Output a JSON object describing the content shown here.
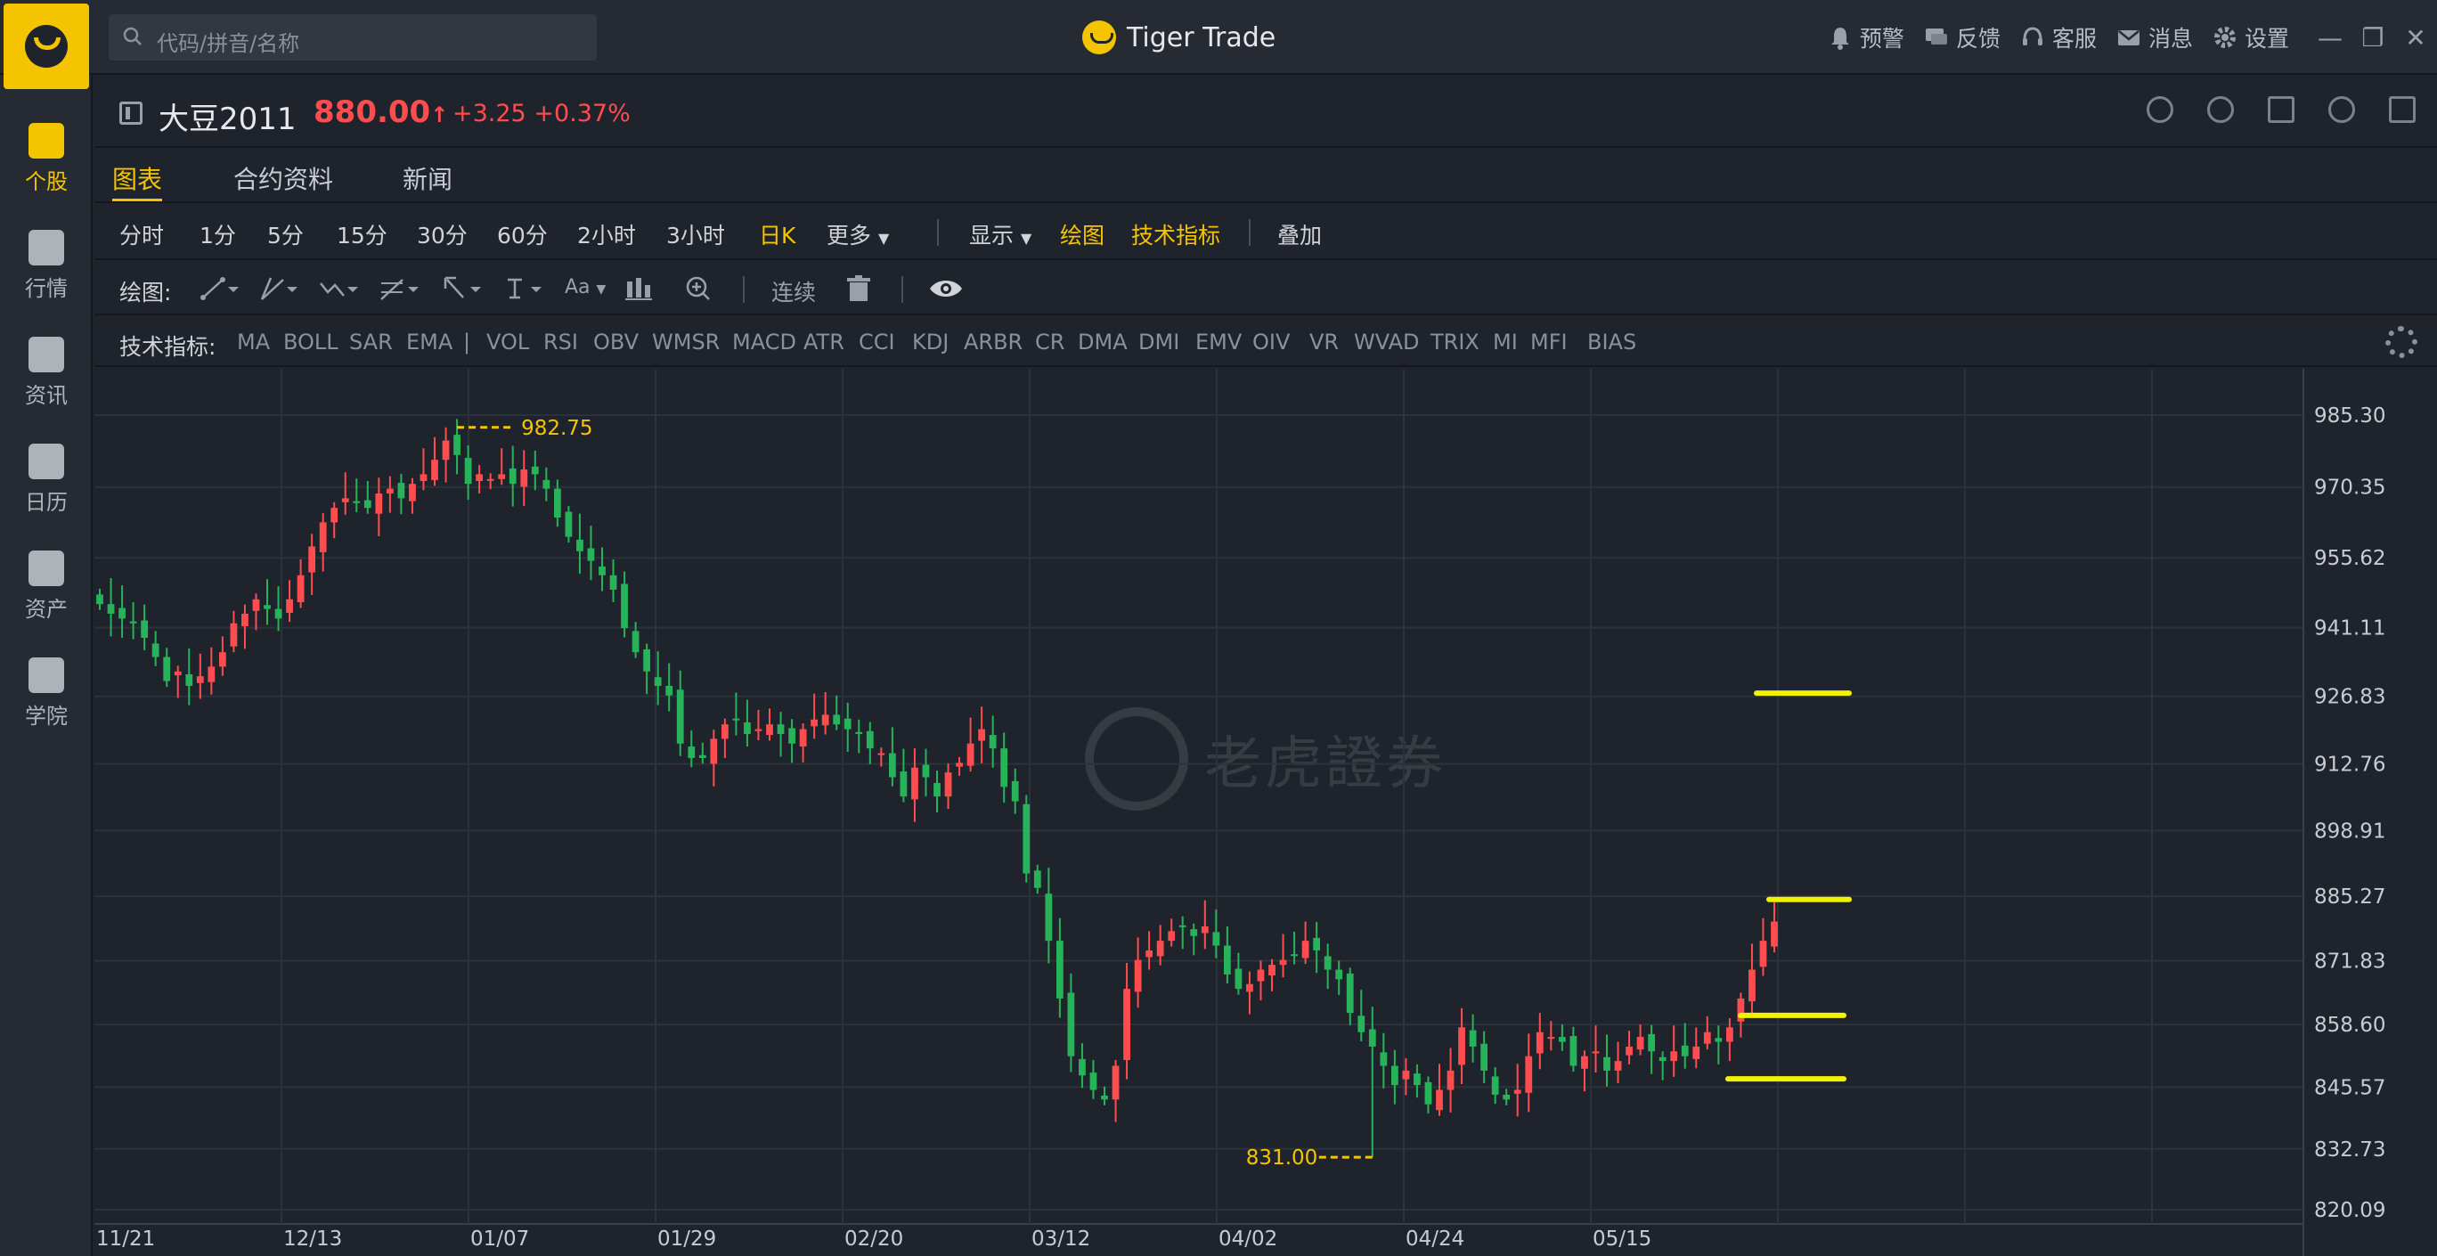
{
  "app": {
    "brand": "Tiger Trade"
  },
  "search": {
    "placeholder": "代码/拼音/名称"
  },
  "top_nav": [
    {
      "label": "预警",
      "icon": "bell-icon"
    },
    {
      "label": "反馈",
      "icon": "chat-icon"
    },
    {
      "label": "客服",
      "icon": "headset-icon"
    },
    {
      "label": "消息",
      "icon": "mail-icon"
    },
    {
      "label": "设置",
      "icon": "gear-icon"
    }
  ],
  "window_controls": {
    "minimize": "—",
    "restore": "❐",
    "close": "✕"
  },
  "sidebar": [
    {
      "label": "个股",
      "icon": "stock-icon",
      "active": true
    },
    {
      "label": "行情",
      "icon": "market-icon",
      "active": false
    },
    {
      "label": "资讯",
      "icon": "news-icon",
      "active": false
    },
    {
      "label": "日历",
      "icon": "calendar-icon",
      "active": false
    },
    {
      "label": "资产",
      "icon": "wallet-icon",
      "active": false
    },
    {
      "label": "学院",
      "icon": "play-icon",
      "active": false
    }
  ],
  "quote": {
    "symbol": "大豆2011",
    "price": "880.00",
    "arrow": "↑",
    "change": "+3.25 +0.37%"
  },
  "tabs": [
    "图表",
    "合约资料",
    "新闻"
  ],
  "periods": [
    "分时",
    "1分",
    "5分",
    "15分",
    "30分",
    "60分",
    "2小时",
    "3小时",
    "日K",
    "更多"
  ],
  "period_selected": "日K",
  "display_menu": {
    "display": "显示",
    "draw": "绘图",
    "indicators": "技术指标",
    "overlay": "叠加"
  },
  "draw_toolbar": {
    "label": "绘图:",
    "continuous": "连续",
    "font_tool": "Aa"
  },
  "indicators": {
    "label": "技术指标:",
    "items": [
      "MA",
      "BOLL",
      "SAR",
      "EMA",
      "|",
      "VOL",
      "RSI",
      "OBV",
      "WMSR",
      "MACD",
      "ATR",
      "CCI",
      "KDJ",
      "ARBR",
      "CR",
      "DMA",
      "DMI",
      "EMV",
      "OIV",
      "VR",
      "WVAD",
      "TRIX",
      "MI",
      "MFI",
      "BIAS"
    ]
  },
  "watermark": {
    "text": "老虎證券"
  },
  "colors": {
    "accent": "#f5c400",
    "up": "#ff4d4f",
    "down": "#26b35a",
    "background": "#1f242c"
  },
  "chart_data": {
    "type": "candlestick",
    "title": "",
    "x_ticks": [
      "11/21",
      "12/13",
      "01/07",
      "01/29",
      "02/20",
      "03/12",
      "04/02",
      "04/24",
      "05/15"
    ],
    "y_ticks": [
      "985.30",
      "970.35",
      "955.62",
      "941.11",
      "926.83",
      "912.76",
      "898.91",
      "885.27",
      "871.83",
      "858.60",
      "845.57",
      "832.73",
      "820.09"
    ],
    "ylim": [
      820.09,
      985.3
    ],
    "annotations": [
      {
        "text": "982.75",
        "value": 982.75,
        "type": "high"
      },
      {
        "text": "831.00",
        "value": 831.0,
        "type": "low"
      }
    ],
    "user_lines": [
      927.5,
      884.6,
      860.5,
      847.3
    ],
    "closes": [
      946,
      944,
      943,
      942,
      939,
      935,
      930,
      932,
      929,
      931,
      933,
      936,
      942,
      944,
      947,
      945,
      943,
      947,
      952,
      958,
      963,
      966,
      968,
      967,
      966,
      969,
      970,
      968,
      971,
      973,
      976,
      980,
      977,
      971,
      973,
      972,
      973,
      971,
      974,
      973,
      970,
      964,
      960,
      957,
      955,
      952,
      949,
      941,
      936,
      932,
      929,
      927,
      917,
      914,
      914,
      918,
      921,
      922,
      919,
      920,
      921,
      919,
      917,
      920,
      922,
      923,
      921,
      920,
      919,
      916,
      915,
      910,
      906,
      912,
      910,
      906,
      911,
      913,
      917,
      920,
      916,
      908,
      905,
      890,
      887,
      876,
      864,
      852,
      848,
      845,
      843,
      850,
      866,
      872,
      874,
      876,
      878,
      879,
      877,
      879,
      875,
      869,
      866,
      867,
      870,
      871,
      872,
      873,
      876,
      874,
      870,
      868,
      861,
      857,
      854,
      850,
      846,
      849,
      846,
      842,
      845,
      849,
      858,
      854,
      849,
      844,
      843,
      845,
      852,
      857,
      856,
      855,
      850,
      852,
      853,
      849,
      851,
      854,
      856,
      853,
      851,
      853,
      852,
      854,
      857,
      855,
      858,
      864,
      870,
      876,
      880
    ]
  }
}
